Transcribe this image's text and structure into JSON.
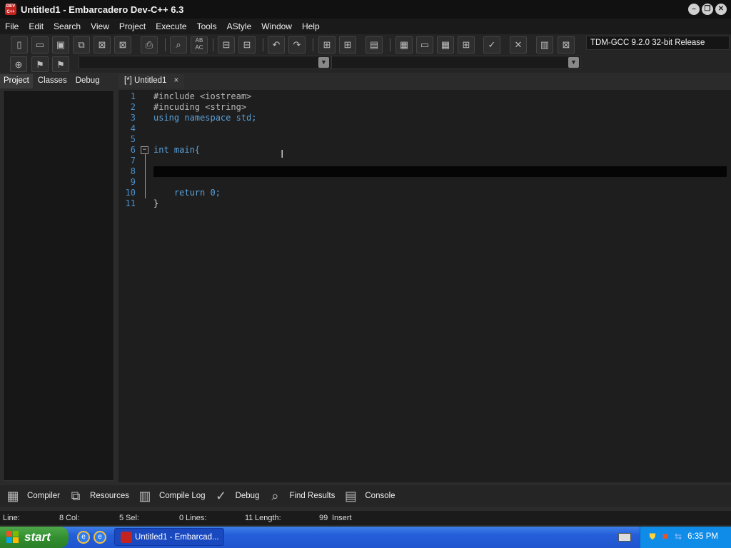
{
  "window": {
    "app_icon": "DEV\nC++",
    "title": "Untitled1 - Embarcadero Dev-C++ 6.3",
    "controls": [
      "minimize",
      "restore",
      "close"
    ]
  },
  "menu": [
    "File",
    "Edit",
    "Search",
    "View",
    "Project",
    "Execute",
    "Tools",
    "AStyle",
    "Window",
    "Help"
  ],
  "toolbar": {
    "compiler": "TDM-GCC 9.2.0 32-bit Release",
    "replace_icon_text": "AB\nAC"
  },
  "left_tabs": [
    "Project",
    "Classes",
    "Debug"
  ],
  "editor_tab": {
    "label": "[*] Untitled1",
    "close": "×"
  },
  "code_lines": [
    {
      "num": "1",
      "text": "#include <iostream>"
    },
    {
      "num": "2",
      "text": "#incuding <string>"
    },
    {
      "num": "3",
      "text": "using namespace std;"
    },
    {
      "num": "4",
      "text": ""
    },
    {
      "num": "5",
      "text": ""
    },
    {
      "num": "6",
      "text": "int main{"
    },
    {
      "num": "7",
      "text": ""
    },
    {
      "num": "8",
      "text": ""
    },
    {
      "num": "9",
      "text": ""
    },
    {
      "num": "10",
      "text": "    return 0;"
    },
    {
      "num": "11",
      "text": "}"
    }
  ],
  "bottom_tabs": [
    "Compiler",
    "Resources",
    "Compile Log",
    "Debug",
    "Find Results",
    "Console"
  ],
  "status": {
    "line_label": "Line:",
    "line_value": "8",
    "col_label": "Col:",
    "col_value": "5",
    "sel_label": "Sel:",
    "sel_value": "0",
    "lines_label": "Lines:",
    "lines_value": "11",
    "length_label": "Length:",
    "length_value": "99",
    "mode": "Insert"
  },
  "taskbar": {
    "start": "start",
    "task_button": "Untitled1 - Embarcad...",
    "clock": "6:35 PM"
  }
}
